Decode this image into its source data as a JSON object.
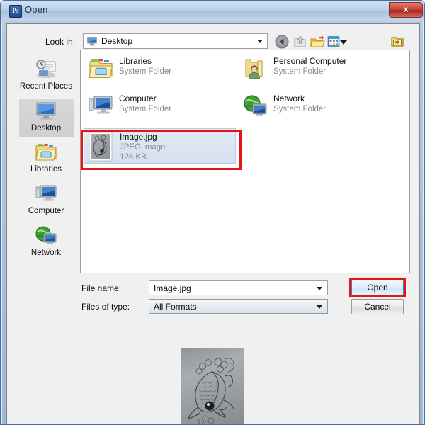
{
  "window": {
    "title": "Open",
    "app_icon": "photoshop-ps-icon",
    "close_label": "x"
  },
  "toolbar": {
    "lookin_label": "Look in:",
    "lookin_value": "Desktop",
    "lookin_icon": "desktop-monitor-icon",
    "buttons": [
      {
        "name": "back-button",
        "icon": "back-arrow-icon"
      },
      {
        "name": "up-one-level-button",
        "icon": "up-folder-arrow-icon"
      },
      {
        "name": "create-new-folder-button",
        "icon": "new-folder-icon"
      },
      {
        "name": "views-button",
        "icon": "views-grid-icon"
      },
      {
        "name": "tools-button",
        "icon": "yellow-folder-star-icon"
      }
    ]
  },
  "places_bar": {
    "items": [
      {
        "label": "Recent Places",
        "icon": "recent-places-icon",
        "selected": false
      },
      {
        "label": "Desktop",
        "icon": "desktop-monitor-icon",
        "selected": true
      },
      {
        "label": "Libraries",
        "icon": "libraries-folder-icon",
        "selected": false
      },
      {
        "label": "Computer",
        "icon": "computer-monitor-icon",
        "selected": false
      },
      {
        "label": "Network",
        "icon": "network-globe-icon",
        "selected": false
      }
    ]
  },
  "file_list": {
    "items": [
      {
        "name": "Libraries",
        "type": "System Folder",
        "size": "",
        "icon": "libraries-folder-icon",
        "selected": false,
        "column": 0,
        "row": 0
      },
      {
        "name": "Personal Computer",
        "type": "System Folder",
        "size": "",
        "icon": "user-folder-icon",
        "selected": false,
        "column": 1,
        "row": 0
      },
      {
        "name": "Computer",
        "type": "System Folder",
        "size": "",
        "icon": "computer-monitor-icon",
        "selected": false,
        "column": 0,
        "row": 1
      },
      {
        "name": "Network",
        "type": "System Folder",
        "size": "",
        "icon": "network-globe-icon",
        "selected": false,
        "column": 1,
        "row": 1
      },
      {
        "name": "Image.jpg",
        "type": "JPEG image",
        "size": "126 KB",
        "icon": "jpeg-thumbnail-icon",
        "selected": true,
        "column": 0,
        "row": 2
      }
    ]
  },
  "form": {
    "filename_label": "File name:",
    "filename_value": "Image.jpg",
    "filetype_label": "Files of type:",
    "filetype_value": "All Formats"
  },
  "buttons": {
    "open_label": "Open",
    "cancel_label": "Cancel"
  },
  "preview": {
    "description": "koi-fish-pencil-sketch"
  },
  "annotations": {
    "highlight_color": "#e81313",
    "highlighted": [
      "selected-file-row",
      "open-button"
    ]
  }
}
